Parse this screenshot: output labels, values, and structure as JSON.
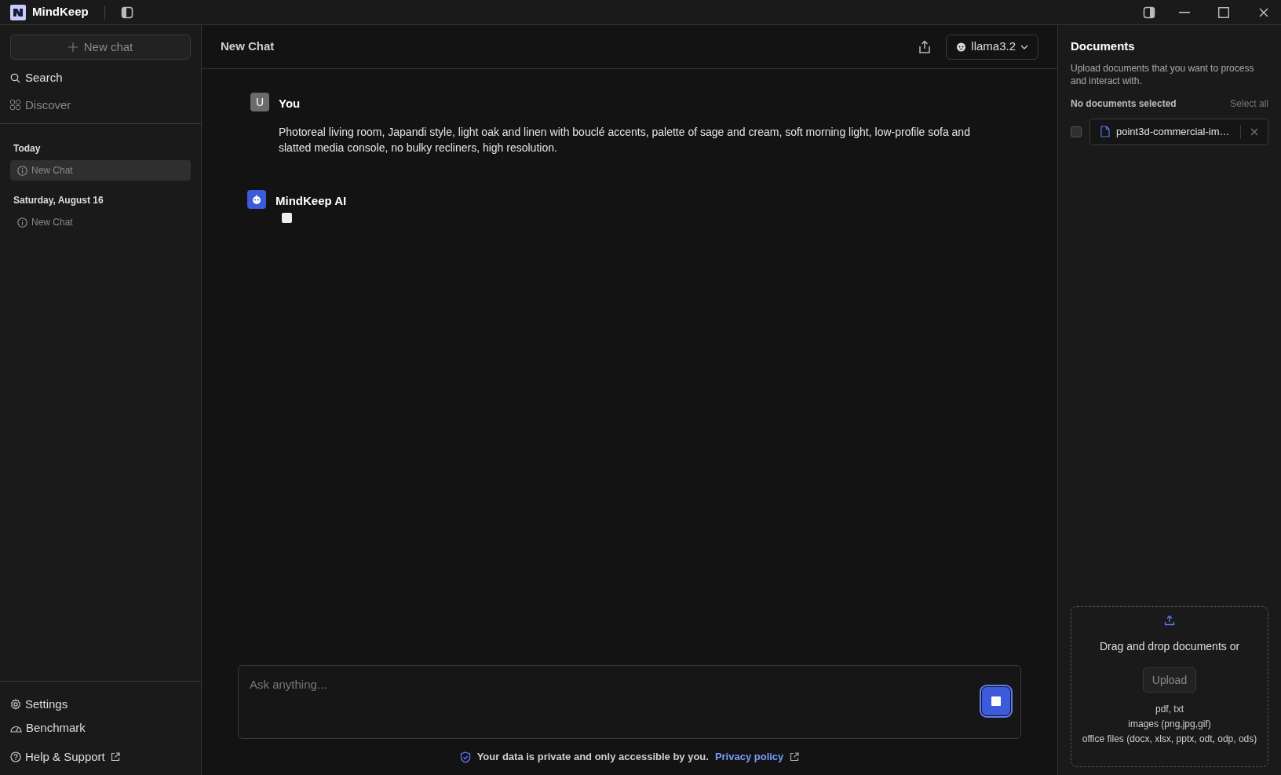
{
  "app": {
    "name": "MindKeep"
  },
  "sidebar": {
    "new_chat": "New chat",
    "nav": [
      {
        "kind": "search",
        "label": "Search",
        "disabled": false
      },
      {
        "kind": "discover",
        "label": "Discover",
        "disabled": true
      }
    ],
    "groups": [
      {
        "heading": "Today",
        "items": [
          {
            "label": "New Chat",
            "selected": true
          }
        ]
      },
      {
        "heading": "Saturday, August 16",
        "items": [
          {
            "label": "New Chat",
            "selected": false
          }
        ]
      }
    ],
    "footer": [
      {
        "kind": "settings",
        "label": "Settings",
        "external": false
      },
      {
        "kind": "benchmark",
        "label": "Benchmark",
        "external": false
      },
      {
        "kind": "help",
        "label": "Help & Support",
        "external": true
      }
    ]
  },
  "chat": {
    "title": "New Chat",
    "model": "llama3.2",
    "messages": [
      {
        "kind": "user",
        "avatar": "U",
        "author": "You",
        "text": "Photoreal living room, Japandi style, light oak and linen with bouclé accents, palette of sage and cream, soft morning light, low-profile sofa and slatted media console, no bulky recliners, high resolution.",
        "typing": false
      },
      {
        "kind": "assistant",
        "author": "MindKeep AI",
        "typing": true
      }
    ],
    "input": {
      "placeholder": "Ask anything..."
    },
    "privacy": {
      "text": "Your data is private and only accessible by you.",
      "link": "Privacy policy"
    }
  },
  "documents": {
    "title": "Documents",
    "description": "Upload documents that you want to process and interact with.",
    "status": "No documents selected",
    "select_all": "Select all",
    "files": [
      {
        "name": "point3d-commercial-im…",
        "checked": false
      }
    ],
    "dropzone": {
      "text": "Drag and drop documents or",
      "button": "Upload",
      "types": [
        "pdf, txt",
        "images (png,jpg,gif)",
        "office files (docx, xlsx, pptx, odt, odp, ods)"
      ]
    }
  }
}
